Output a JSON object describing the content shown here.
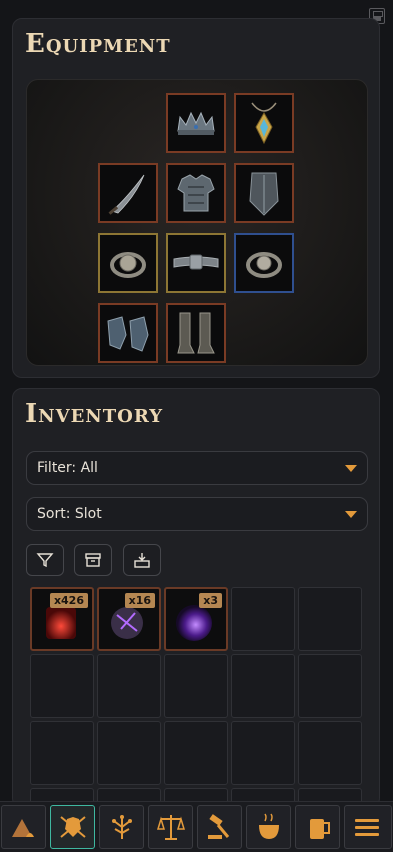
{
  "equipment": {
    "title": "Equipment",
    "slots": [
      {
        "name": "helmet",
        "item": "crown-icon",
        "rarity": "red"
      },
      {
        "name": "amulet",
        "item": "amulet-icon",
        "rarity": "red"
      },
      {
        "name": "weapon",
        "item": "curved-sword-icon",
        "rarity": "red"
      },
      {
        "name": "body-armor",
        "item": "chest-armor-icon",
        "rarity": "red"
      },
      {
        "name": "shield",
        "item": "shield-icon",
        "rarity": "red"
      },
      {
        "name": "ring-left",
        "item": "ring-icon",
        "rarity": "gold"
      },
      {
        "name": "belt",
        "item": "belt-icon",
        "rarity": "gold"
      },
      {
        "name": "ring-right",
        "item": "ring-icon",
        "rarity": "blue"
      },
      {
        "name": "gloves",
        "item": "gauntlets-icon",
        "rarity": "red"
      },
      {
        "name": "boots",
        "item": "boots-icon",
        "rarity": "red"
      }
    ]
  },
  "inventory": {
    "title": "Inventory",
    "filter_label": "Filter: All",
    "sort_label": "Sort: Slot",
    "tools": [
      "filter-icon",
      "archive-icon",
      "unequip-icon"
    ],
    "items": [
      {
        "icon": "red-crystal-icon",
        "count": "x426"
      },
      {
        "icon": "purple-shard-icon",
        "count": "x16"
      },
      {
        "icon": "purple-orb-icon",
        "count": "x3"
      }
    ]
  },
  "nav": {
    "items": [
      "camp-icon",
      "equipment-icon",
      "skill-tree-icon",
      "balance-icon",
      "crafting-icon",
      "cauldron-icon",
      "tavern-icon",
      "menu-icon"
    ],
    "active": "equipment-icon"
  },
  "colors": {
    "accent": "#e39a3b",
    "active_nav": "#3fb8a0",
    "badge": "#b58752"
  }
}
